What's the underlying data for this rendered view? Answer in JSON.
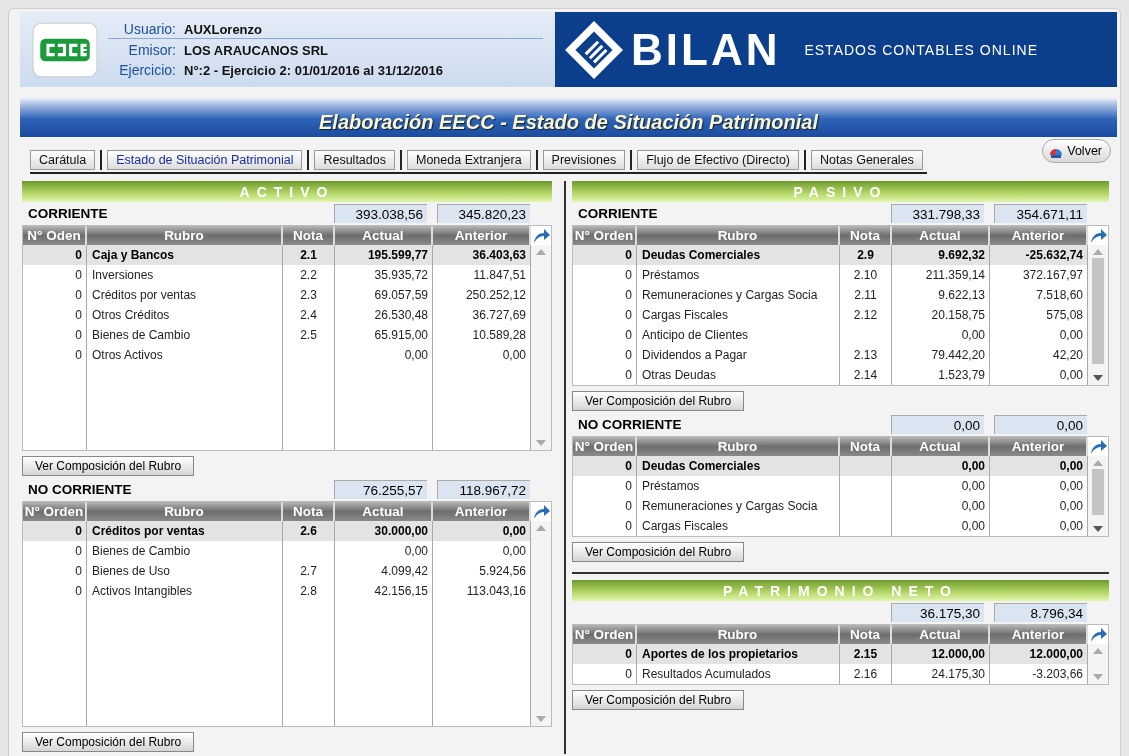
{
  "header": {
    "fields": [
      {
        "label": "Usuario:",
        "value": "AUXLorenzo"
      },
      {
        "label": "Emisor:",
        "value": "LOS ARAUCANOS SRL"
      },
      {
        "label": "Ejercicio:",
        "value": "N°:2 - Ejercicio 2: 01/01/2016 al 31/12/2016"
      }
    ],
    "brand": "BILAN",
    "tagline": "ESTADOS CONTABLES ONLINE"
  },
  "title": "Elaboración EECC - Estado de Situación Patrimonial",
  "back_button": "Volver",
  "tabs": [
    {
      "label": "Carátula",
      "selected": false
    },
    {
      "label": "Estado de Situación Patrimonial",
      "selected": true
    },
    {
      "label": "Resultados",
      "selected": false
    },
    {
      "label": "Moneda Extranjera",
      "selected": false
    },
    {
      "label": "Previsiones",
      "selected": false
    },
    {
      "label": "Flujo de Efectivo (Directo)",
      "selected": false
    },
    {
      "label": "Notas Generales",
      "selected": false
    }
  ],
  "columns": [
    {
      "sections": [
        {
          "title": "ACTIVO",
          "groups": [
            {
              "label": "CORRIENTE",
              "total_actual": "393.038,56",
              "total_anterior": "345.820,23",
              "scrollable": false,
              "columns": [
                "N° Oden",
                "Rubro",
                "Nota",
                "Actual",
                "Anterior"
              ],
              "button": "Ver Composición del Rubro",
              "rows": [
                {
                  "orden": "0",
                  "rubro": "Caja y Bancos",
                  "nota": "2.1",
                  "actual": "195.599,77",
                  "anterior": "36.403,63",
                  "selected": true
                },
                {
                  "orden": "0",
                  "rubro": "Inversiones",
                  "nota": "2.2",
                  "actual": "35.935,72",
                  "anterior": "11.847,51",
                  "selected": false
                },
                {
                  "orden": "0",
                  "rubro": "Créditos por ventas",
                  "nota": "2.3",
                  "actual": "69.057,59",
                  "anterior": "250.252,12",
                  "selected": false
                },
                {
                  "orden": "0",
                  "rubro": "Otros Créditos",
                  "nota": "2.4",
                  "actual": "26.530,48",
                  "anterior": "36.727,69",
                  "selected": false
                },
                {
                  "orden": "0",
                  "rubro": "Bienes de Cambio",
                  "nota": "2.5",
                  "actual": "65.915,00",
                  "anterior": "10.589,28",
                  "selected": false
                },
                {
                  "orden": "0",
                  "rubro": "Otros Activos",
                  "actual": "0,00",
                  "anterior": "0,00",
                  "selected": false
                }
              ]
            },
            {
              "label": "NO CORRIENTE",
              "total_actual": "76.255,57",
              "total_anterior": "118.967,72",
              "scrollable": false,
              "columns": [
                "N° Orden",
                "Rubro",
                "Nota",
                "Actual",
                "Anterior"
              ],
              "button": "Ver Composición del Rubro",
              "rows": [
                {
                  "orden": "0",
                  "rubro": "Créditos por ventas",
                  "nota": "2.6",
                  "actual": "30.000,00",
                  "anterior": "0,00",
                  "selected": true
                },
                {
                  "orden": "0",
                  "rubro": "Bienes de Cambio",
                  "actual": "0,00",
                  "anterior": "0,00",
                  "selected": false
                },
                {
                  "orden": "0",
                  "rubro": "Bienes de Uso",
                  "nota": "2.7",
                  "actual": "4.099,42",
                  "anterior": "5.924,56",
                  "selected": false
                },
                {
                  "orden": "0",
                  "rubro": "Activos Intangibles",
                  "nota": "2.8",
                  "actual": "42.156,15",
                  "anterior": "113.043,16",
                  "selected": false
                }
              ]
            }
          ]
        }
      ]
    },
    {
      "sections": [
        {
          "title": "PASIVO",
          "groups": [
            {
              "label": "CORRIENTE",
              "total_actual": "331.798,33",
              "total_anterior": "354.671,11",
              "scrollable": true,
              "columns": [
                "N° Orden",
                "Rubro",
                "Nota",
                "Actual",
                "Anterior"
              ],
              "button": "Ver Composición del Rubro",
              "rows": [
                {
                  "orden": "0",
                  "rubro": "Deudas Comerciales",
                  "nota": "2.9",
                  "actual": "9.692,32",
                  "anterior": "-25.632,74",
                  "selected": true
                },
                {
                  "orden": "0",
                  "rubro": "Préstamos",
                  "nota": "2.10",
                  "actual": "211.359,14",
                  "anterior": "372.167,97",
                  "selected": false
                },
                {
                  "orden": "0",
                  "rubro": "Remuneraciones y Cargas Socia",
                  "nota": "2.11",
                  "actual": "9.622,13",
                  "anterior": "7.518,60",
                  "selected": false
                },
                {
                  "orden": "0",
                  "rubro": "Cargas Fiscales",
                  "nota": "2.12",
                  "actual": "20.158,75",
                  "anterior": "575,08",
                  "selected": false
                },
                {
                  "orden": "0",
                  "rubro": "Anticipo de Clientes",
                  "actual": "0,00",
                  "anterior": "0,00",
                  "selected": false
                },
                {
                  "orden": "0",
                  "rubro": "Dividendos a Pagar",
                  "nota": "2.13",
                  "actual": "79.442,20",
                  "anterior": "42,20",
                  "selected": false
                },
                {
                  "orden": "0",
                  "rubro": "Otras Deudas",
                  "nota": "2.14",
                  "actual": "1.523,79",
                  "anterior": "0,00",
                  "selected": false
                }
              ]
            },
            {
              "label": "NO CORRIENTE",
              "total_actual": "0,00",
              "total_anterior": "0,00",
              "scrollable": true,
              "columns": [
                "N° Orden",
                "Rubro",
                "Nota",
                "Actual",
                "Anterior"
              ],
              "button": "Ver Composición del Rubro",
              "rows": [
                {
                  "orden": "0",
                  "rubro": "Deudas Comerciales",
                  "actual": "0,00",
                  "anterior": "0,00",
                  "selected": true
                },
                {
                  "orden": "0",
                  "rubro": "Préstamos",
                  "actual": "0,00",
                  "anterior": "0,00",
                  "selected": false
                },
                {
                  "orden": "0",
                  "rubro": "Remuneraciones y Cargas Socia",
                  "actual": "0,00",
                  "anterior": "0,00",
                  "selected": false
                },
                {
                  "orden": "0",
                  "rubro": "Cargas Fiscales",
                  "actual": "0,00",
                  "anterior": "0,00",
                  "selected": false
                }
              ]
            }
          ]
        },
        {
          "title": "PATRIMONIO NETO",
          "groups": [
            {
              "total_actual": "36.175,30",
              "total_anterior": "8.796,34",
              "scrollable": false,
              "columns": [
                "N° Orden",
                "Rubro",
                "Nota",
                "Actual",
                "Anterior"
              ],
              "button": "Ver Composición del Rubro",
              "rows": [
                {
                  "orden": "0",
                  "rubro": "Aportes de los propietarios",
                  "nota": "2.15",
                  "actual": "12.000,00",
                  "anterior": "12.000,00",
                  "selected": true
                },
                {
                  "orden": "0",
                  "rubro": "Resultados Acumulados",
                  "nota": "2.16",
                  "actual": "24.175,30",
                  "anterior": "-3.203,66",
                  "selected": false
                }
              ]
            }
          ]
        }
      ]
    }
  ]
}
